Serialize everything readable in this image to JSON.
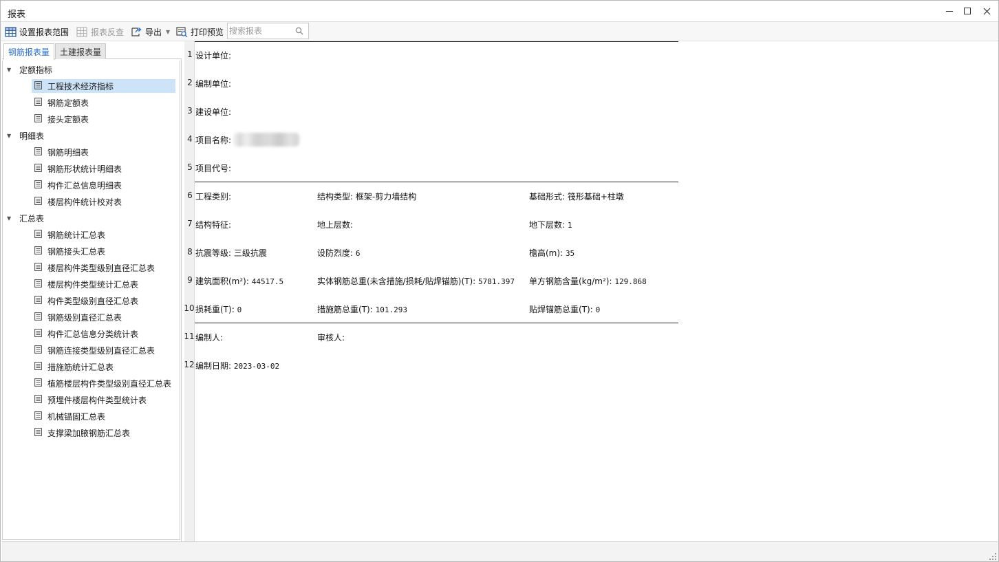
{
  "window": {
    "title": "报表"
  },
  "toolbar": {
    "set_range": "设置报表范围",
    "reverse_check": "报表反查",
    "export": "导出",
    "print_preview": "打印预览",
    "search_placeholder": "搜索报表"
  },
  "tabs": {
    "rebar": "钢筋报表量",
    "civil": "土建报表量"
  },
  "tree": {
    "groups": [
      {
        "label": "定额指标"
      },
      {
        "label": "明细表"
      },
      {
        "label": "汇总表"
      }
    ],
    "items": [
      {
        "label": "工程技术经济指标",
        "selected": true
      },
      {
        "label": "钢筋定额表"
      },
      {
        "label": "接头定额表"
      },
      {
        "label": "钢筋明细表"
      },
      {
        "label": "钢筋形状统计明细表"
      },
      {
        "label": "构件汇总信息明细表"
      },
      {
        "label": "楼层构件统计校对表"
      },
      {
        "label": "钢筋统计汇总表"
      },
      {
        "label": "钢筋接头汇总表"
      },
      {
        "label": "楼层构件类型级别直径汇总表"
      },
      {
        "label": "楼层构件类型统计汇总表"
      },
      {
        "label": "构件类型级别直径汇总表"
      },
      {
        "label": "钢筋级别直径汇总表"
      },
      {
        "label": "构件汇总信息分类统计表"
      },
      {
        "label": "钢筋连接类型级别直径汇总表"
      },
      {
        "label": "措施筋统计汇总表"
      },
      {
        "label": "植筋楼层构件类型级别直径汇总表"
      },
      {
        "label": "预埋件楼层构件类型统计表"
      },
      {
        "label": "机械锚固汇总表"
      },
      {
        "label": "支撑梁加腋钢筋汇总表"
      }
    ]
  },
  "report": {
    "row_numbers": [
      "1",
      "2",
      "3",
      "4",
      "5",
      "6",
      "7",
      "8",
      "9",
      "10",
      "11",
      "12"
    ],
    "design_unit": "设计单位:",
    "compile_unit": "编制单位:",
    "build_unit": "建设单位:",
    "project_name": "项目名称:",
    "project_code": "项目代号:",
    "project_type": "工程类别:",
    "structure_type_label": "结构类型:",
    "structure_type_value": "框架-剪力墙结构",
    "foundation_label": "基础形式:",
    "foundation_value": "筏形基础+柱墩",
    "structure_feature": "结构特征:",
    "floors_above": "地上层数:",
    "floors_below_label": "地下层数:",
    "floors_below_value": "1",
    "seismic_grade_label": "抗震等级:",
    "seismic_grade_value": "三级抗震",
    "fortification_label": "设防烈度:",
    "fortification_value": "6",
    "eave_height_label": "檐高(m):",
    "eave_height_value": "35",
    "building_area_label": "建筑面积(m²):",
    "building_area_value": "44517.5",
    "rebar_weight_label": "实体钢筋总重(未含措施/损耗/贴焊锚筋)(T):",
    "rebar_weight_value": "5781.397",
    "unit_rebar_label": "单方钢筋含量(kg/m²):",
    "unit_rebar_value": "129.868",
    "loss_weight_label": "损耗重(T):",
    "loss_weight_value": "0",
    "measure_weight_label": "措施筋总重(T):",
    "measure_weight_value": "101.293",
    "weld_weight_label": "贴焊锚筋总重(T):",
    "weld_weight_value": "0",
    "compiler": "编制人:",
    "reviewer": "审核人:",
    "compile_date_label": "编制日期:",
    "compile_date_value": "2023-03-02"
  }
}
